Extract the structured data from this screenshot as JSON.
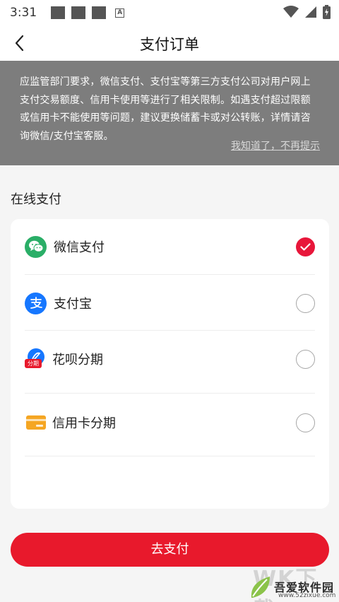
{
  "status_bar": {
    "time": "3:31"
  },
  "header": {
    "title": "支付订单"
  },
  "notice": {
    "text": "应监管部门要求，微信支付、支付宝等第三方支付公司对用户网上支付交易额度、信用卡使用等进行了相关限制。如遇支付超过限额或信用卡不能使用等问题，建议更换储蓄卡或对公转账，详情请咨询微信/支付宝客服。",
    "dismiss": "我知道了，不再提示"
  },
  "section": {
    "title": "在线支付"
  },
  "payment_methods": [
    {
      "label": "微信支付",
      "icon": "wechat-pay-icon",
      "selected": true
    },
    {
      "label": "支付宝",
      "icon": "alipay-icon",
      "selected": false
    },
    {
      "label": "花呗分期",
      "icon": "huabei-icon",
      "icon_text": "分期",
      "selected": false
    },
    {
      "label": "信用卡分期",
      "icon": "credit-card-icon",
      "selected": false
    }
  ],
  "submit": {
    "label": "去支付"
  },
  "watermark": {
    "big": "WK下载",
    "name": "吾爱软件园",
    "url": "www.52zixue.com"
  },
  "colors": {
    "accent": "#e8192c",
    "notice_bg": "#7d7d7d",
    "wechat_green": "#2aae67",
    "alipay_blue": "#1677ff",
    "card_orange": "#f5a623"
  }
}
